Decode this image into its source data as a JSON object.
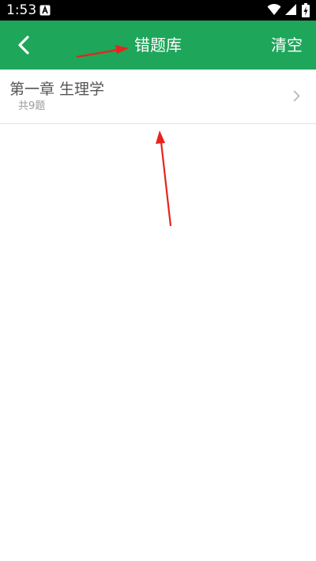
{
  "status_bar": {
    "time": "1:53",
    "notification_icon": "a-notification-icon",
    "icons": [
      "wifi-icon",
      "signal-icon",
      "battery-icon"
    ]
  },
  "header": {
    "back_icon": "chevron-left-icon",
    "title": "错题库",
    "clear_label": "清空",
    "background_color": "#1ea65a"
  },
  "list": {
    "items": [
      {
        "title": "第一章 生理学",
        "count": "共9题",
        "chevron_icon": "chevron-right-icon"
      }
    ]
  },
  "annotations": {
    "color": "#e8231d",
    "arrows": [
      "arrow-pointing-to-title",
      "arrow-pointing-to-list-item"
    ]
  }
}
